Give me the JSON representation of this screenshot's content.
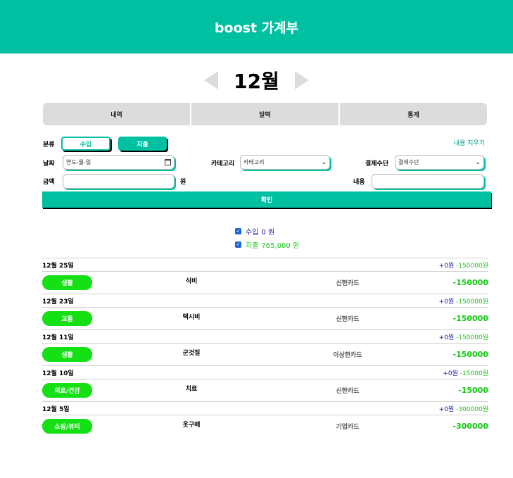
{
  "app": {
    "title": "boost 가계부"
  },
  "month_nav": {
    "label": "12월"
  },
  "tabs": [
    "내역",
    "달력",
    "통계"
  ],
  "form": {
    "category_label": "분류",
    "income_label": "수입",
    "expense_label": "지출",
    "clear_label": "내용 지우기",
    "date_label": "날짜",
    "date_value": "연도-월-일",
    "category_field_label": "카테고리",
    "category_placeholder": "카테고리",
    "payment_label": "결제수단",
    "payment_placeholder": "결제수단",
    "amount_label": "금액",
    "amount_unit": "원",
    "amount_value": "",
    "content_label": "내용",
    "content_value": "",
    "confirm_label": "확인"
  },
  "filters": {
    "income": {
      "name": "수입",
      "amount": "0 원",
      "checked": true
    },
    "expense": {
      "name": "지출",
      "amount": "765,000 원",
      "checked": true
    }
  },
  "groups": [
    {
      "date": "12월 25일",
      "income": "+0원",
      "expense": "-150000원",
      "item": {
        "category": "생활",
        "name": "식비",
        "card": "신한카드",
        "amount": "-150000"
      }
    },
    {
      "date": "12월 23일",
      "income": "+0원",
      "expense": "-150000원",
      "item": {
        "category": "교통",
        "name": "택시비",
        "card": "신한카드",
        "amount": "-150000"
      }
    },
    {
      "date": "12월 11일",
      "income": "+0원",
      "expense": "-150000원",
      "item": {
        "category": "생활",
        "name": "군것질",
        "card": "이상한카드",
        "amount": "-150000"
      }
    },
    {
      "date": "12월 10일",
      "income": "+0원",
      "expense": "-15000원",
      "item": {
        "category": "의료/건강",
        "name": "치료",
        "card": "신한카드",
        "amount": "-15000"
      }
    },
    {
      "date": "12월 5일",
      "income": "+0원",
      "expense": "-300000원",
      "item": {
        "category": "쇼핑/뷰티",
        "name": "옷구매",
        "card": "기업카드",
        "amount": "-300000"
      }
    }
  ],
  "colors": {
    "accent": "#00c0a2",
    "expense_green": "#14c814",
    "income_blue": "#1515aa",
    "badge_green": "#14e014"
  }
}
